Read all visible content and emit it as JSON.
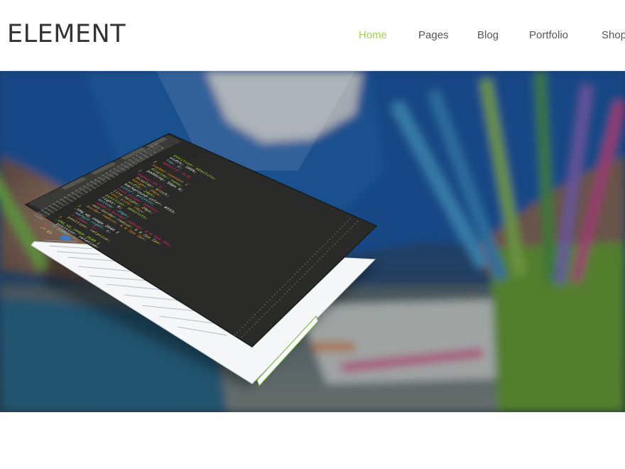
{
  "brand": {
    "logo_text": "ELEMENT"
  },
  "nav": {
    "items": [
      {
        "label": "Home",
        "active": true
      },
      {
        "label": "Pages",
        "active": false
      },
      {
        "label": "Blog",
        "active": false
      },
      {
        "label": "Portfolio",
        "active": false
      },
      {
        "label": "Shop",
        "active": false
      }
    ]
  },
  "colors": {
    "accent": "#a7cf55",
    "logo": "#333333",
    "nav_text": "#555555"
  },
  "hero": {
    "image_description_icon": "hero-photo",
    "code_lines": [
      "position: absolute;",
      "width: 100%;",
      "top: 0;",
      "opacity: 0.9;",
      "}",
      ".topbar-content {",
      "display: none;",
      "padding: 50px 0;",
      "}",
      ".topbar-sh {",
      "display: block;",
      "height: 24px;",
      "width: 24px;",
      "background-color: #333;",
      "color: #ffffff;",
      "text-align: center;",
      "line-height: 24px;",
      "font-size: 14px;",
      "position: absolute;",
      "right: 0;",
      "bottom: -24px;",
      "-webkit-border-radius: 0 0 2px 2px;",
      "-moz-border-radius: 0 0 2px 2px;",
      "border-radius: 0 0 2px 2px;",
      "}",
      ".img_wp_image_2640 {",
      "margin-right: 0;",
      "z-index: 1;",
      "position: relative;",
      "}",
      ".img_wp_image_2648 {",
      "position: relative;",
      "z-index: 1;",
      "}",
      "/* ES"
    ],
    "line_numbers": [
      "4376",
      "4377",
      "4378",
      "4379",
      "4380",
      "4381",
      "4382",
      "4383",
      "4384",
      "4385",
      "4386",
      "4387",
      "4388",
      "4389",
      "4390",
      "4391",
      "4392",
      "4393",
      "4394",
      "4395",
      "4396",
      "4397",
      "4398",
      "4399",
      "4400",
      "4401",
      "4402",
      "4403",
      "4404",
      "4405",
      "4406",
      "4407",
      "4408"
    ]
  }
}
